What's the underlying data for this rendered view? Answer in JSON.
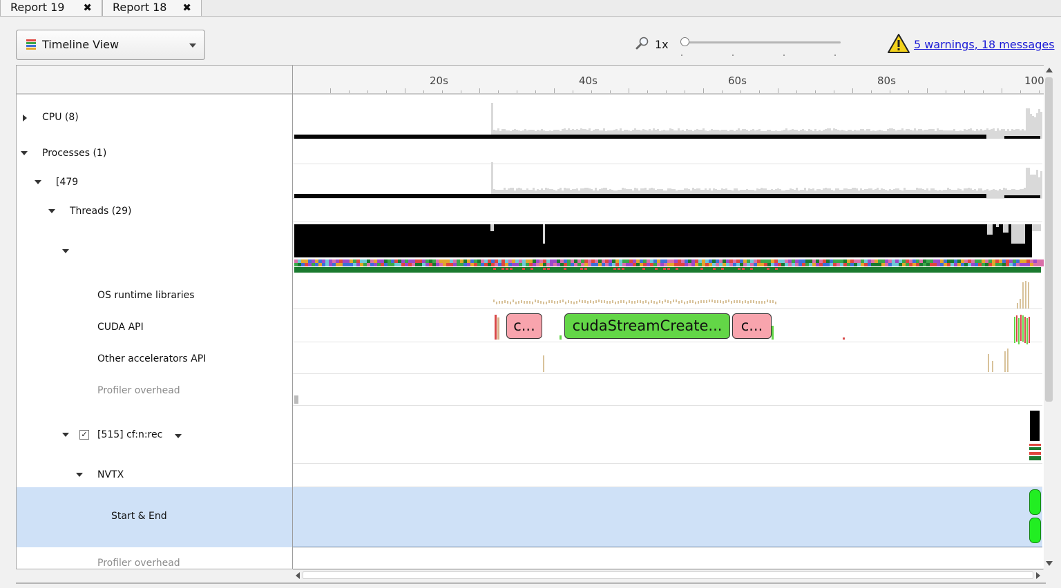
{
  "tabs": [
    {
      "label": "Report 19",
      "close": "✖"
    },
    {
      "label": "Report 18",
      "close": "✖"
    }
  ],
  "toolbar": {
    "view_select": "Timeline View",
    "zoom_level": "1x",
    "zoom_fraction": 0.0,
    "warnings_link": "5 warnings, 18 messages"
  },
  "timeline": {
    "ruler_labels": [
      "20s",
      "40s",
      "60s",
      "80s",
      "100"
    ],
    "rows": {
      "cpu": "CPU (8)",
      "processes": "Processes (1)",
      "process": "[479",
      "threads": "Threads (29)",
      "os_runtime": "OS runtime libraries",
      "cuda_api": "CUDA API",
      "other_accel": "Other accelerators API",
      "profiler_overhead_1": "Profiler overhead",
      "thread_515": "[515] cf:n:rec",
      "nvtx": "NVTX",
      "start_end": "Start & End",
      "profiler_overhead_2": "Profiler overhead"
    },
    "cuda_calls": [
      {
        "label": "c...",
        "kind": "pink"
      },
      {
        "label": "cudaStreamCreate...",
        "kind": "green"
      },
      {
        "label": "c...",
        "kind": "pink"
      }
    ],
    "thread_checkbox": "✓"
  },
  "colors": {
    "selection": "#cfe1f7",
    "cuda_pink": "#f8a4ad",
    "cuda_green": "#63d647",
    "nvtx_green": "#22ee22",
    "thread_green": "#1a7a2f",
    "link": "#1a1ad6",
    "warning": "#f3d21c"
  },
  "icons": {
    "zoom": "magnifier-icon",
    "warning": "warning-triangle-icon",
    "view": "timeline-stack-icon",
    "dropdown": "chevron-down-icon"
  }
}
